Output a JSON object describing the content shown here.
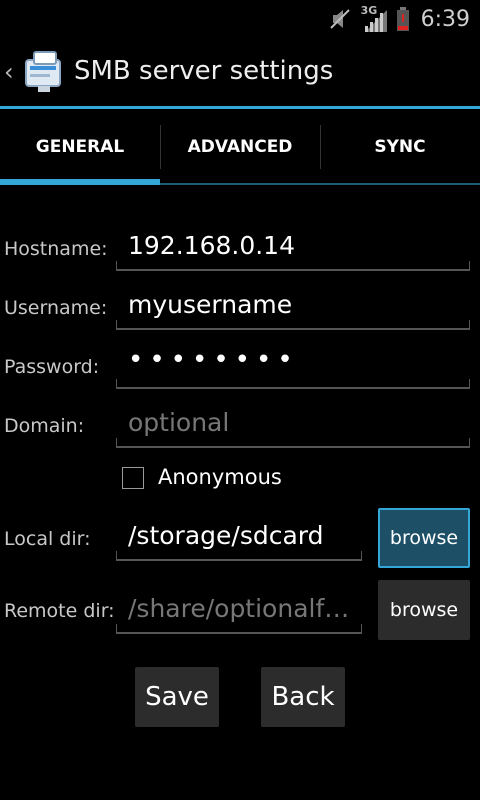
{
  "status_bar": {
    "time": "6:39",
    "network": "3G",
    "icons": [
      "mute-icon",
      "signal-icon",
      "battery-low-icon"
    ]
  },
  "action_bar": {
    "title": "SMB server settings",
    "icons": [
      "up-chevron-icon",
      "app-icon"
    ]
  },
  "tabs": [
    {
      "label": "GENERAL",
      "selected": true
    },
    {
      "label": "ADVANCED",
      "selected": false
    },
    {
      "label": "SYNC",
      "selected": false
    }
  ],
  "form": {
    "hostname": {
      "label": "Hostname:",
      "value": "192.168.0.14"
    },
    "username": {
      "label": "Username:",
      "value": "myusername"
    },
    "password": {
      "label": "Password:",
      "value": "••••••••"
    },
    "domain": {
      "label": "Domain:",
      "placeholder": "optional"
    },
    "anonymous": {
      "label": "Anonymous",
      "checked": false
    },
    "local_dir": {
      "label": "Local dir:",
      "value": "/storage/sdcard",
      "browse_label": "browse"
    },
    "remote_dir": {
      "label": "Remote dir:",
      "placeholder": "/share/optionalf…",
      "browse_label": "browse"
    }
  },
  "buttons": {
    "save": "Save",
    "back": "Back"
  },
  "colors": {
    "accent": "#33a7d8",
    "background": "#000000",
    "button": "#2c2c2c"
  }
}
